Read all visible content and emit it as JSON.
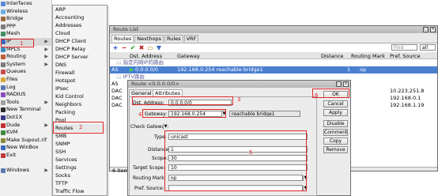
{
  "left_menu": [
    {
      "label": "Interfaces",
      "color": "#5a8ad6"
    },
    {
      "label": "Wireless",
      "color": "#6fb0e6"
    },
    {
      "label": "Bridge",
      "color": "#9a6a3a"
    },
    {
      "label": "PPP",
      "color": "#7a7a7a"
    },
    {
      "label": "Mesh",
      "color": "#3f8f5f"
    },
    {
      "label": "IP",
      "color": "#3a6abf",
      "arrow": "▶"
    },
    {
      "label": "MPLS",
      "color": "#3a8abf",
      "arrow": "▶"
    },
    {
      "label": "Routing",
      "color": "#bf5a3a",
      "arrow": "▶"
    },
    {
      "label": "System",
      "color": "#7a7a7a",
      "arrow": "▶"
    },
    {
      "label": "Queues",
      "color": "#c94a4a"
    },
    {
      "label": "Files",
      "color": "#d9a63a"
    },
    {
      "label": "Log",
      "color": "#5a7aaf"
    },
    {
      "label": "RADIUS",
      "color": "#8a4abf"
    },
    {
      "label": "Tools",
      "color": "#a0a0a0",
      "arrow": "▶"
    },
    {
      "label": "New Terminal",
      "color": "#2a2a2a"
    },
    {
      "label": "Dot1X",
      "color": "#3a3a8a"
    },
    {
      "label": "Dude",
      "color": "#c03030",
      "arrow": "▶"
    },
    {
      "label": "KVM",
      "color": "#3a8a3a"
    },
    {
      "label": "Make Supout.rif",
      "color": "#8a8a3a"
    },
    {
      "label": "New WinBox",
      "color": "#3a6abf"
    },
    {
      "label": "Exit",
      "color": "#bf3a3a"
    },
    {
      "label": "",
      "color": "#f0f0f0"
    },
    {
      "label": "Windows",
      "color": "#5a7aaf",
      "arrow": "▶"
    }
  ],
  "submenu": [
    "ARP",
    "Accounting",
    "Addresses",
    "Cloud",
    "DHCP Client",
    "DHCP Relay",
    "DHCP Server",
    "DNS",
    "Firewall",
    "Hotspot",
    "IPsec",
    "Kid Control",
    "Neighbors",
    "Packing",
    "Pool",
    "Routes",
    "SMB",
    "SNMP",
    "SSH",
    "Services",
    "Settings",
    "Socks",
    "TFTP",
    "Traffic Flow"
  ],
  "route_list": {
    "title": "Route List",
    "tabs": [
      "Routes",
      "Nexthops",
      "Rules",
      "VRF"
    ],
    "find_placeholder": "Find",
    "filter": "all",
    "headers": [
      "Dst. Address",
      "Gateway",
      "Distance",
      "Routing Mark",
      "Pref. Source"
    ],
    "comment_row": ";;; 指定内网IP的路由",
    "rows": [
      {
        "flag": "AS",
        "dst": "",
        "gw": "192.168.0.254 reachable bridge1",
        "dist": "1",
        "mark": "op",
        "pref": ""
      },
      {
        "flag": "",
        "dst": ";;; IPTV路由",
        "gw": "",
        "dist": "",
        "mark": "",
        "pref": ""
      },
      {
        "flag": "AS",
        "dst": "",
        "gw": "",
        "dist": "",
        "mark": "",
        "pref": ""
      },
      {
        "flag": "DAC",
        "dst": "",
        "gw": "",
        "dist": "",
        "mark": "",
        "pref": "10.223.251.8"
      },
      {
        "flag": "DAC",
        "dst": "",
        "gw": "",
        "dist": "",
        "mark": "",
        "pref": "192.168.0.1"
      },
      {
        "flag": "DAC",
        "dst": "",
        "gw": "",
        "dist": "",
        "mark": "",
        "pref": "192.168.1.19"
      }
    ],
    "status": "6 items"
  },
  "route_dialog": {
    "title": "Route <0.0.0.0/0>",
    "tabs": [
      "General",
      "Attributes"
    ],
    "dst_label": "Dst. Address:",
    "dst_value": "0.0.0.0/0",
    "gateway_label": "Gateway:",
    "gateway_value": "192.168.0.254",
    "gateway_status": "reachable bridge1",
    "check_gateway_label": "Check Gateway:",
    "type_label": "Type:",
    "type_value": "unicast",
    "distance_label": "Distance:",
    "distance_value": "1",
    "scope_label": "Scope:",
    "scope_value": "30",
    "target_scope_label": "Target Scope:",
    "target_scope_value": "10",
    "routing_mark_label": "Routing Mark:",
    "routing_mark_value": "op",
    "pref_source_label": "Pref. Source:",
    "pref_source_value": "",
    "buttons": [
      "OK",
      "Cancel",
      "Apply",
      "Disable",
      "Comment",
      "Copy",
      "Remove"
    ]
  },
  "annotations": [
    "1",
    "2",
    "3",
    "4",
    "5",
    "6"
  ],
  "annotation_color": "#e0282a"
}
